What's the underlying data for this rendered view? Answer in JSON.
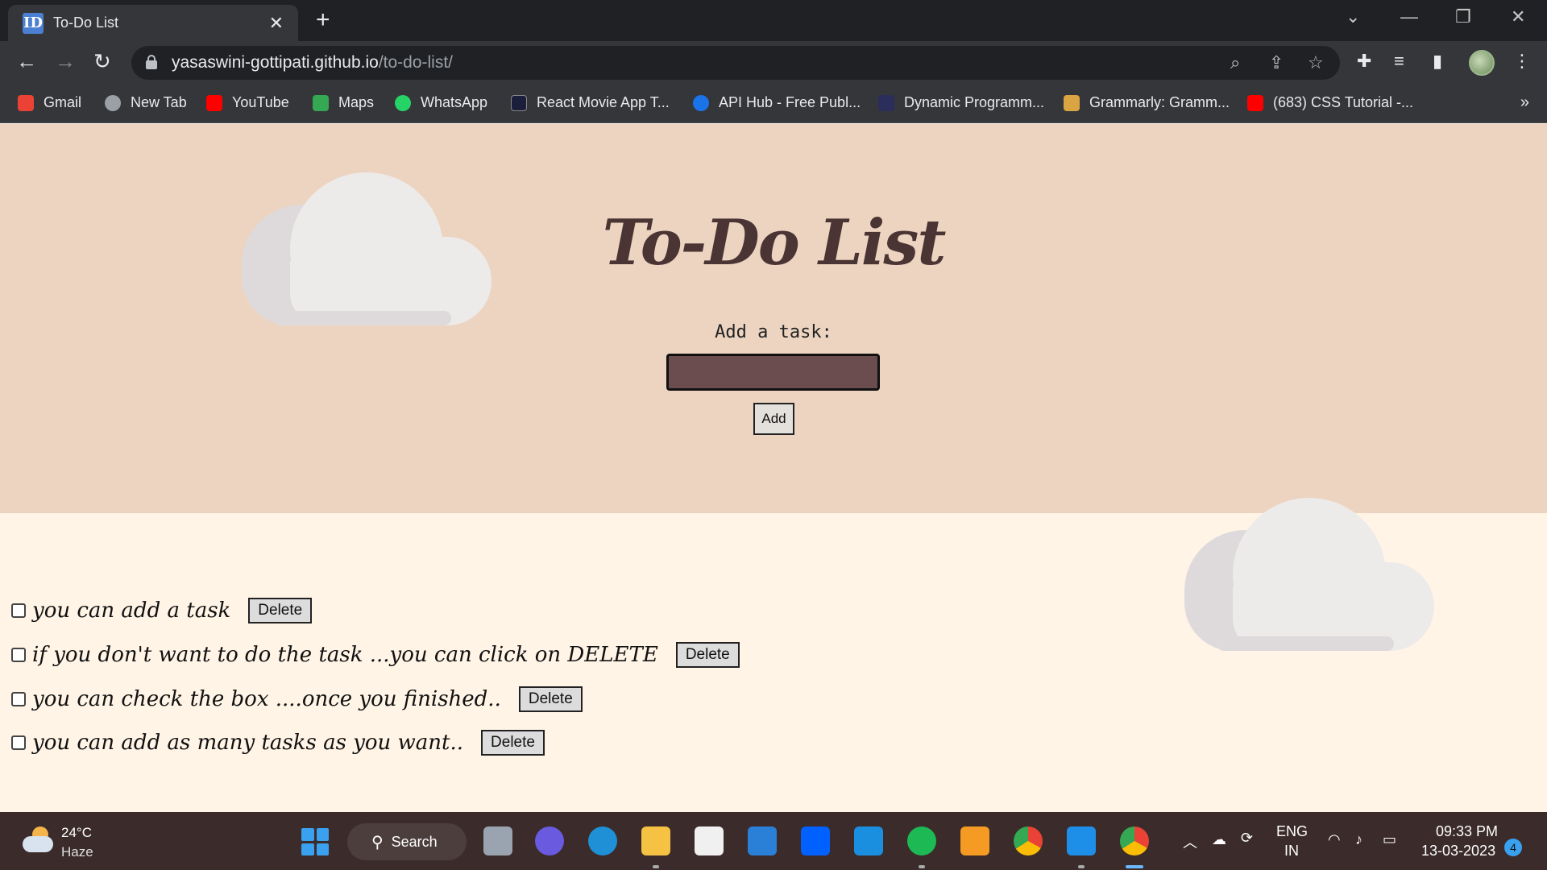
{
  "browser": {
    "tab_title": "To-Do List",
    "tab_favicon_text": "ID",
    "url_domain": "yasaswini-gottipati.github.io",
    "url_path": "/to-do-list/",
    "bookmarks": [
      {
        "label": "Gmail",
        "icon": "gmail-icon",
        "color": "#ea4335"
      },
      {
        "label": "New Tab",
        "icon": "globe-icon",
        "color": "#9aa0a6"
      },
      {
        "label": "YouTube",
        "icon": "youtube-icon",
        "color": "#ff0000"
      },
      {
        "label": "Maps",
        "icon": "maps-icon",
        "color": "#34a853"
      },
      {
        "label": "WhatsApp",
        "icon": "whatsapp-icon",
        "color": "#25d366"
      },
      {
        "label": "React Movie App T...",
        "icon": "react-icon",
        "color": "#1b1f3b"
      },
      {
        "label": "API Hub - Free Publ...",
        "icon": "apihub-icon",
        "color": "#1a73e8"
      },
      {
        "label": "Dynamic Programm...",
        "icon": "page-icon",
        "color": "#2b2d5a"
      },
      {
        "label": "Grammarly: Gramm...",
        "icon": "grammarly-icon",
        "color": "#d9a441"
      },
      {
        "label": "(683) CSS Tutorial -...",
        "icon": "youtube-icon",
        "color": "#ff0000"
      }
    ],
    "bookmarks_more": "»"
  },
  "page": {
    "title": "To-Do List",
    "add_label": "Add a task:",
    "input_value": "",
    "add_button": "Add",
    "tasks": [
      {
        "text": "you can add a task",
        "checked": false,
        "delete_label": "Delete"
      },
      {
        "text": "if you don't want to do the task ...you can click on DELETE",
        "checked": false,
        "delete_label": "Delete"
      },
      {
        "text": "you can check the box ....once you finished..",
        "checked": false,
        "delete_label": "Delete"
      },
      {
        "text": "you can add as many tasks as you want..",
        "checked": false,
        "delete_label": "Delete"
      }
    ]
  },
  "taskbar": {
    "weather_temp": "24°C",
    "weather_desc": "Haze",
    "search_label": "Search",
    "lang_top": "ENG",
    "lang_bottom": "IN",
    "time": "09:33 PM",
    "date": "13-03-2023",
    "notification_count": "4"
  },
  "colors": {
    "header_bg": "#ecd4c0",
    "page_bg": "#fff4e6",
    "input_bg": "#6b4d4f",
    "title_color": "#4a3434"
  }
}
